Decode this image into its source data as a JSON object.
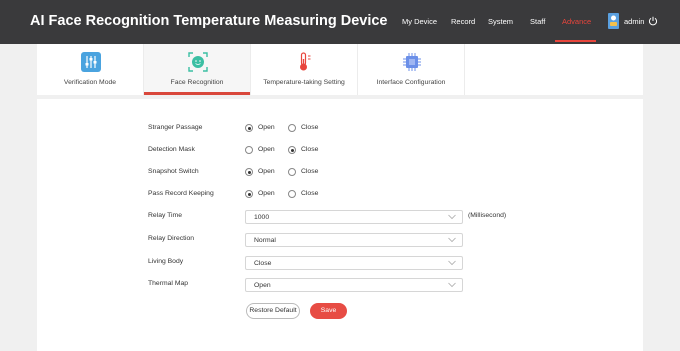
{
  "app": {
    "title": "AI Face Recognition Temperature Measuring Device"
  },
  "nav": {
    "items": [
      {
        "label": "My Device"
      },
      {
        "label": "Record"
      },
      {
        "label": "System"
      },
      {
        "label": "Staff"
      },
      {
        "label": "Advance",
        "active": true
      }
    ],
    "user": {
      "name": "admin",
      "avatar_icon": "user-avatar-icon",
      "logout_icon": "power-icon"
    }
  },
  "tabs": [
    {
      "label": "Verification Mode",
      "icon": "sliders-icon",
      "icon_color": "#4aa3df"
    },
    {
      "label": "Face Recognition",
      "icon": "face-scan-icon",
      "icon_color": "#3bbfa3",
      "active": true
    },
    {
      "label": "Temperature-taking Setting",
      "icon": "thermometer-icon",
      "icon_color": "#e8453c"
    },
    {
      "label": "Interface Configuration",
      "icon": "chip-icon",
      "icon_color": "#6b8fe8"
    }
  ],
  "form": {
    "radio_rows": [
      {
        "label": "Stranger Passage",
        "selected": "Open"
      },
      {
        "label": "Detection Mask",
        "selected": "Close"
      },
      {
        "label": "Snapshot Switch",
        "selected": "Open"
      },
      {
        "label": "Pass Record Keeping",
        "selected": "Open"
      }
    ],
    "option_open": "Open",
    "option_close": "Close",
    "select_rows": [
      {
        "label": "Relay Time",
        "value": "1000",
        "unit": "(Millisecond)"
      },
      {
        "label": "Relay Direction",
        "value": "Normal"
      },
      {
        "label": "Living Body",
        "value": "Close"
      },
      {
        "label": "Thermal Map",
        "value": "Open"
      }
    ],
    "restore_label": "Restore Default",
    "save_label": "Save"
  },
  "colors": {
    "topbar": "#3a3a3c",
    "accent": "#e8453c",
    "save_button": "#e74c44"
  }
}
